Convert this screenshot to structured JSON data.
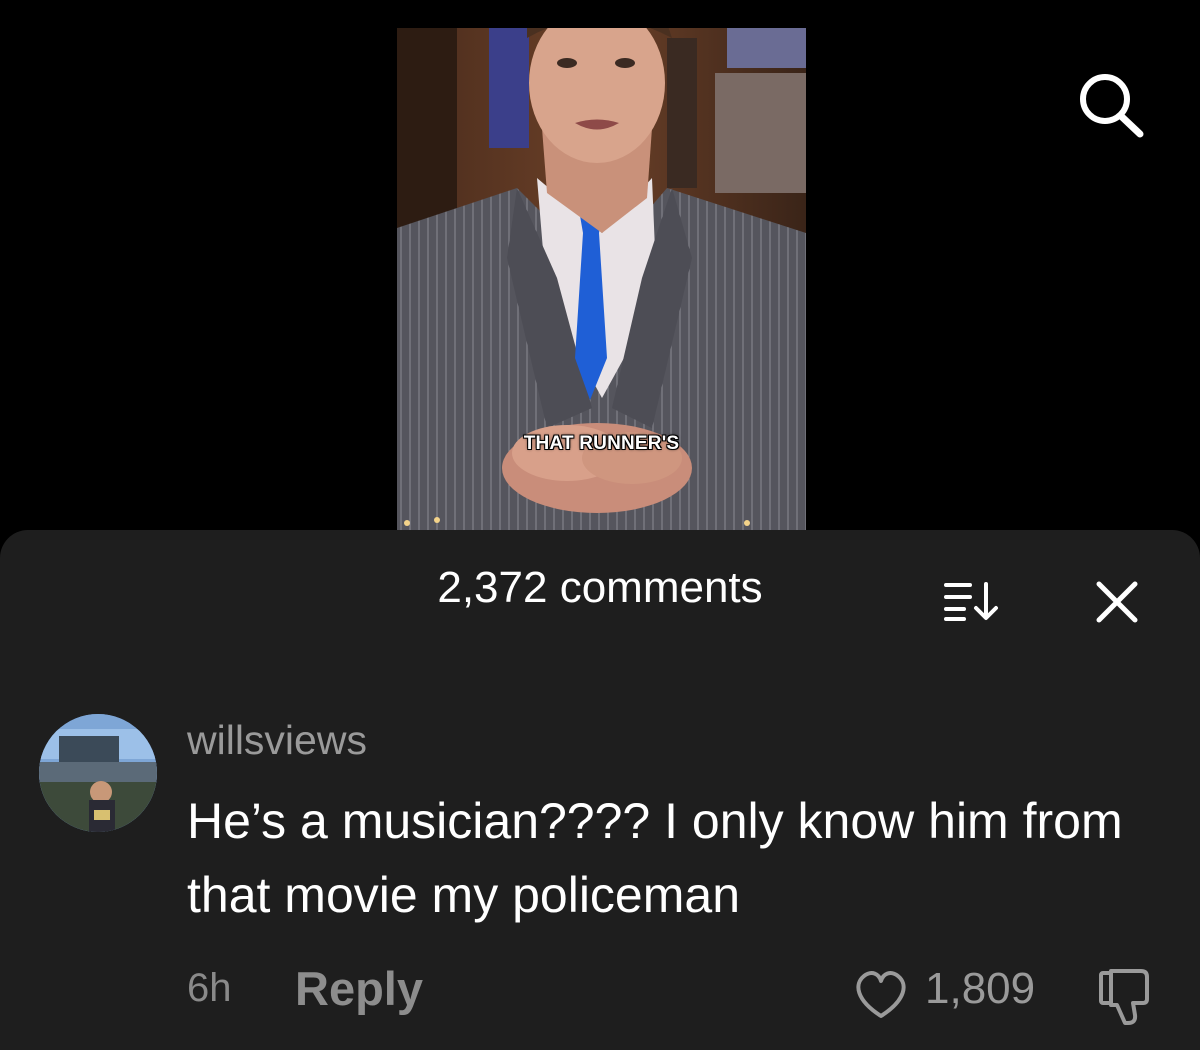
{
  "video": {
    "caption": "THAT RUNNER'S"
  },
  "header": {
    "search_icon": "search-icon"
  },
  "comments_sheet": {
    "title": "2,372 comments",
    "sort_icon": "sort-icon",
    "close_icon": "close-icon"
  },
  "comment": {
    "username": "willsviews",
    "text": "He’s a musician???? I only know him from that movie my policeman",
    "time": "6h",
    "reply_label": "Reply",
    "likes": "1,809",
    "like_icon": "heart-icon",
    "dislike_icon": "thumbs-down-icon"
  },
  "colors": {
    "background": "#000000",
    "sheet": "#1e1e1e",
    "muted_text": "#9a9a9a",
    "tie": "#1f5fd6"
  }
}
